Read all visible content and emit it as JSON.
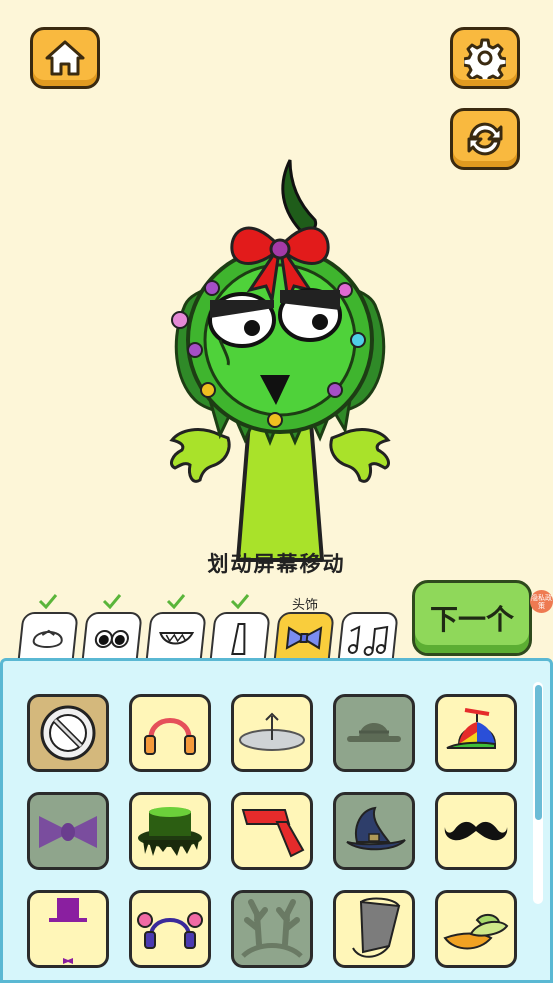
{
  "hint_text": "划动屏幕移动",
  "next_button_label": "下一个",
  "privacy_badge": "隐私政策",
  "selected_category_label": "头饰",
  "categories": [
    {
      "icon": "face-shape-icon",
      "completed": true
    },
    {
      "icon": "eyes-icon",
      "completed": true
    },
    {
      "icon": "mouth-icon",
      "completed": true
    },
    {
      "icon": "body-icon",
      "completed": true
    },
    {
      "icon": "bow-tie-icon",
      "completed": false,
      "selected": true
    },
    {
      "icon": "music-notes-icon",
      "completed": false
    }
  ],
  "items": [
    {
      "icon": "none-icon",
      "locked": false
    },
    {
      "icon": "headphones-icon",
      "locked": false
    },
    {
      "icon": "propeller-disc-icon",
      "locked": false
    },
    {
      "icon": "bowler-hat-icon",
      "locked": true
    },
    {
      "icon": "propeller-cap-icon",
      "locked": false
    },
    {
      "icon": "bow-icon",
      "locked": true
    },
    {
      "icon": "slime-top-hat-icon",
      "locked": false
    },
    {
      "icon": "red-scarf-icon",
      "locked": false
    },
    {
      "icon": "witch-hat-icon",
      "locked": true
    },
    {
      "icon": "mustache-icon",
      "locked": false
    },
    {
      "icon": "tiny-top-hat-icon",
      "locked": false
    },
    {
      "icon": "ear-muffs-icon",
      "locked": false
    },
    {
      "icon": "antlers-icon",
      "locked": true
    },
    {
      "icon": "bucket-icon",
      "locked": false
    },
    {
      "icon": "sun-hat-icon",
      "locked": false
    }
  ],
  "colors": {
    "background": "#fdf6d8",
    "button_orange": "#f9b93f",
    "next_green": "#8fd85a",
    "panel_blue": "#d6f6fb",
    "item_yellow": "#fff6b8",
    "item_locked": "#8fa58c"
  }
}
